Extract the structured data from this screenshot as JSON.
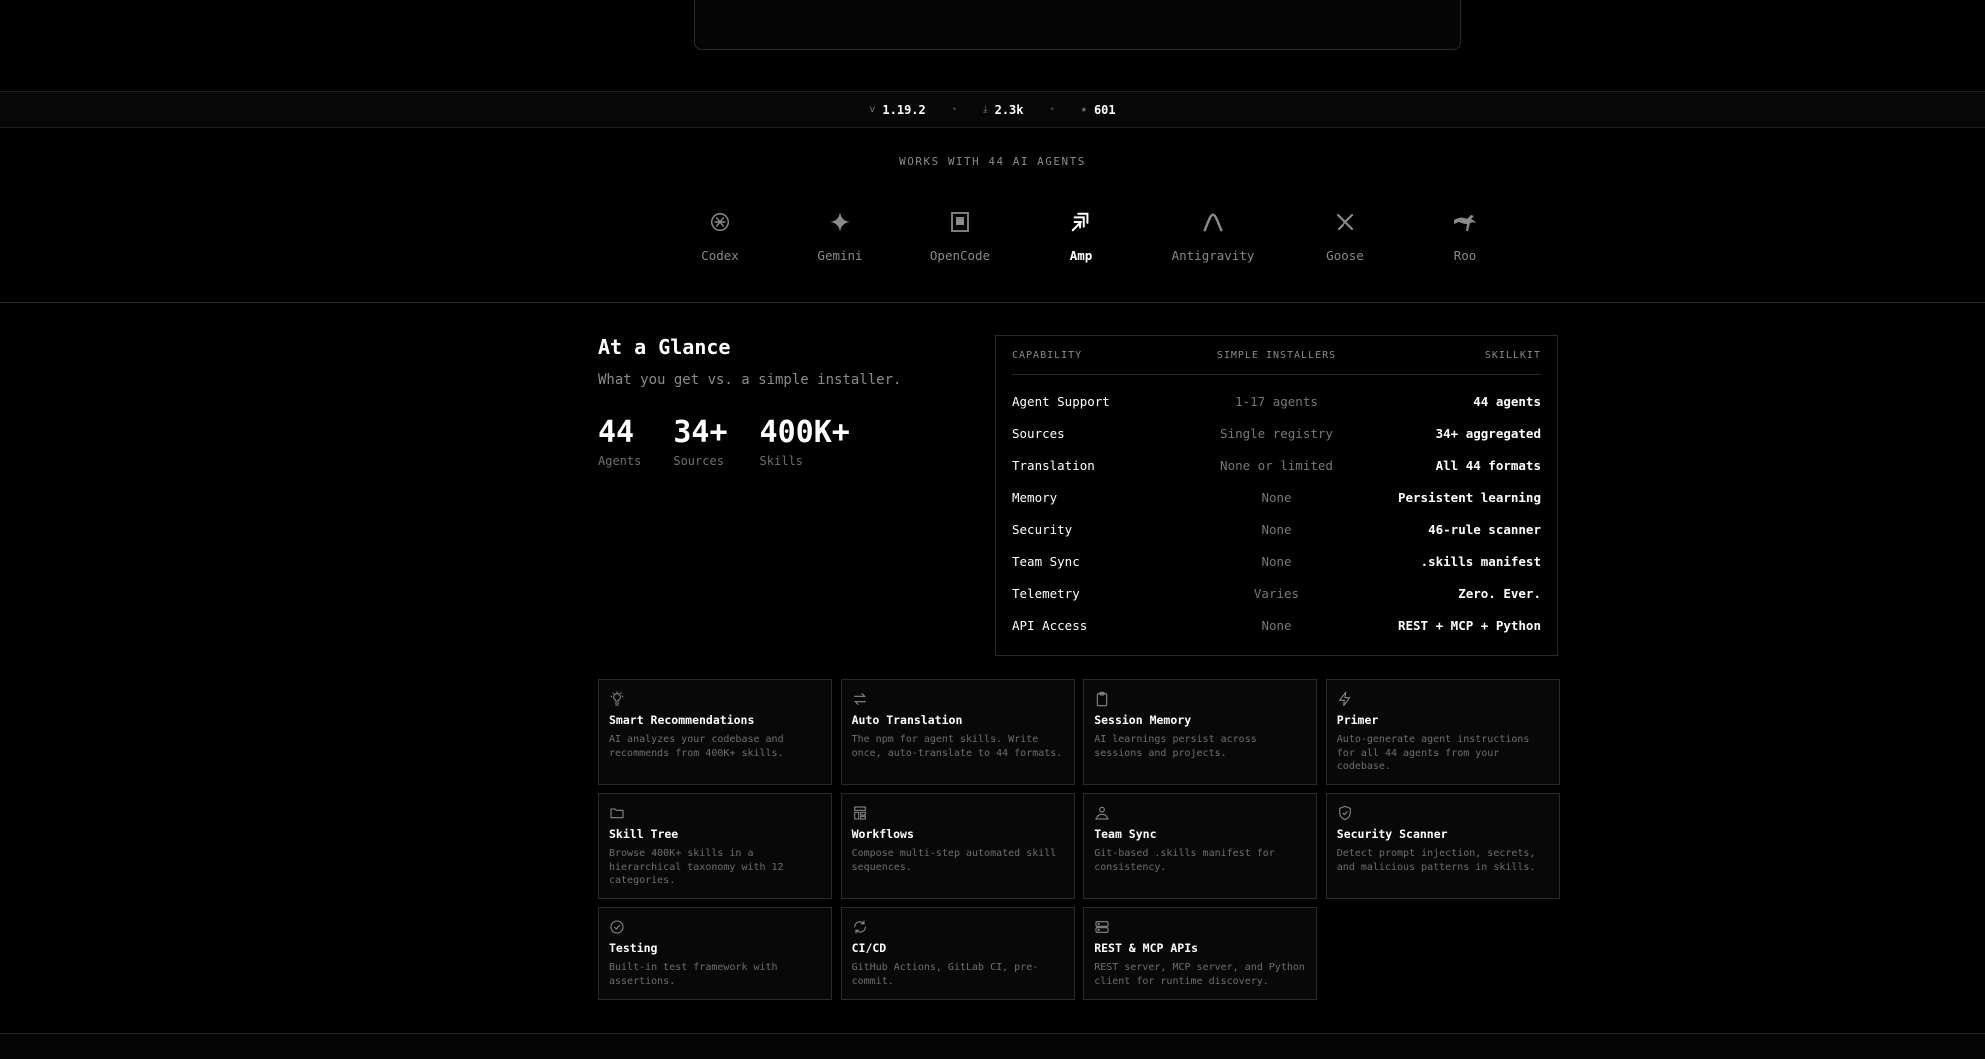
{
  "stats": {
    "version_icon": "v",
    "version": "1.19.2",
    "downloads_icon": "⤓",
    "downloads": "2.3k",
    "stars_icon": "★",
    "stars": "601",
    "separator": "•"
  },
  "agents_section": {
    "title": "WORKS WITH 44 AI AGENTS",
    "agents": [
      {
        "label": "",
        "icon": "partial-moon-icon"
      },
      {
        "label": "Codex",
        "icon": "openai-knot-icon"
      },
      {
        "label": "Gemini",
        "icon": "sparkle-icon"
      },
      {
        "label": "OpenCode",
        "icon": "square-doc-icon"
      },
      {
        "label": "Amp",
        "icon": "amp-logo-icon",
        "active": true
      },
      {
        "label": "Antigravity",
        "icon": "arch-icon"
      },
      {
        "label": "Goose",
        "icon": "goose-icon"
      },
      {
        "label": "Roo",
        "icon": "kangaroo-icon"
      }
    ]
  },
  "glance": {
    "title": "At a Glance",
    "subtitle": "What you get vs. a simple installer.",
    "stats": [
      {
        "num": "44",
        "label": "Agents"
      },
      {
        "num": "34+",
        "label": "Sources"
      },
      {
        "num": "400K+",
        "label": "Skills"
      }
    ]
  },
  "comparison": {
    "headers": [
      "CAPABILITY",
      "SIMPLE INSTALLERS",
      "SKILLKIT"
    ],
    "rows": [
      [
        "Agent Support",
        "1-17 agents",
        "44 agents"
      ],
      [
        "Sources",
        "Single registry",
        "34+ aggregated"
      ],
      [
        "Translation",
        "None or limited",
        "All 44 formats"
      ],
      [
        "Memory",
        "None",
        "Persistent learning"
      ],
      [
        "Security",
        "None",
        "46-rule scanner"
      ],
      [
        "Team Sync",
        "None",
        ".skills manifest"
      ],
      [
        "Telemetry",
        "Varies",
        "Zero. Ever."
      ],
      [
        "API Access",
        "None",
        "REST + MCP + Python"
      ]
    ]
  },
  "features": [
    {
      "icon": "lightbulb-icon",
      "title": "Smart Recommendations",
      "desc": "AI analyzes your codebase and recommends from 400K+ skills."
    },
    {
      "icon": "arrows-swap-icon",
      "title": "Auto Translation",
      "desc": "The npm for agent skills. Write once, auto-translate to 44 formats."
    },
    {
      "icon": "clipboard-icon",
      "title": "Session Memory",
      "desc": "AI learnings persist across sessions and projects."
    },
    {
      "icon": "bolt-icon",
      "title": "Primer",
      "desc": "Auto-generate agent instructions for all 44 agents from your codebase."
    },
    {
      "icon": "folder-icon",
      "title": "Skill Tree",
      "desc": "Browse 400K+ skills in a hierarchical taxonomy with 12 categories."
    },
    {
      "icon": "layout-icon",
      "title": "Workflows",
      "desc": "Compose multi-step automated skill sequences."
    },
    {
      "icon": "users-icon",
      "title": "Team Sync",
      "desc": "Git-based .skills manifest for consistency."
    },
    {
      "icon": "shield-check-icon",
      "title": "Security Scanner",
      "desc": "Detect prompt injection, secrets, and malicious patterns in skills."
    },
    {
      "icon": "check-circle-icon",
      "title": "Testing",
      "desc": "Built-in test framework with assertions."
    },
    {
      "icon": "refresh-icon",
      "title": "CI/CD",
      "desc": "GitHub Actions, GitLab CI, pre-commit."
    },
    {
      "icon": "server-icon",
      "title": "REST & MCP APIs",
      "desc": "REST server, MCP server, and Python client for runtime discovery."
    }
  ]
}
